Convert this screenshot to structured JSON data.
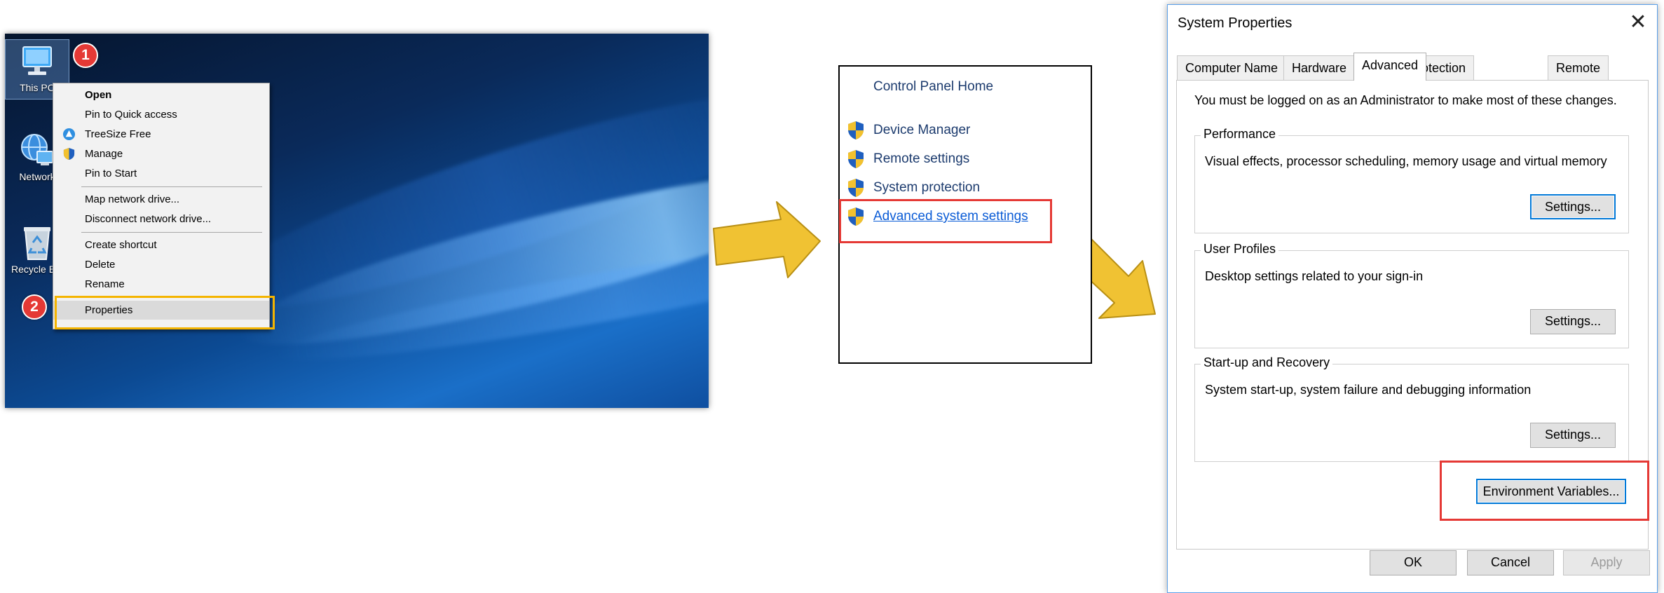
{
  "desktop": {
    "icons": {
      "this_pc": "This PC",
      "network": "Network",
      "recycle_bin": "Recycle Bin"
    },
    "callouts": {
      "one": "1",
      "two": "2"
    },
    "context_menu": {
      "open": "Open",
      "pin_quick_access": "Pin to Quick access",
      "treesize": "TreeSize Free",
      "manage": "Manage",
      "pin_start": "Pin to Start",
      "map_drive": "Map network drive...",
      "disconnect_drive": "Disconnect network drive...",
      "create_shortcut": "Create shortcut",
      "delete": "Delete",
      "rename": "Rename",
      "properties": "Properties"
    }
  },
  "control_panel": {
    "home": "Control Panel Home",
    "links": {
      "device_manager": "Device Manager",
      "remote_settings": "Remote settings",
      "system_protection": "System protection",
      "advanced_settings": "Advanced system settings"
    }
  },
  "system_properties": {
    "title": "System Properties",
    "close_glyph": "✕",
    "tabs": {
      "computer_name": "Computer Name",
      "hardware": "Hardware",
      "advanced": "Advanced",
      "system_protection": "System Protection",
      "remote": "Remote"
    },
    "admin_note": "You must be logged on as an Administrator to make most of these changes.",
    "performance": {
      "title": "Performance",
      "desc": "Visual effects, processor scheduling, memory usage and virtual memory",
      "button": "Settings..."
    },
    "user_profiles": {
      "title": "User Profiles",
      "desc": "Desktop settings related to your sign-in",
      "button": "Settings..."
    },
    "startup_recovery": {
      "title": "Start-up and Recovery",
      "desc": "System start-up, system failure and debugging information",
      "button": "Settings..."
    },
    "env_button": "Environment Variables...",
    "ok": "OK",
    "cancel": "Cancel",
    "apply": "Apply"
  },
  "colors": {
    "highlight_orange": "#f4b400",
    "highlight_red": "#e53935",
    "arrow_yellow": "#f0c233",
    "link_blue": "#0b5cd6"
  }
}
